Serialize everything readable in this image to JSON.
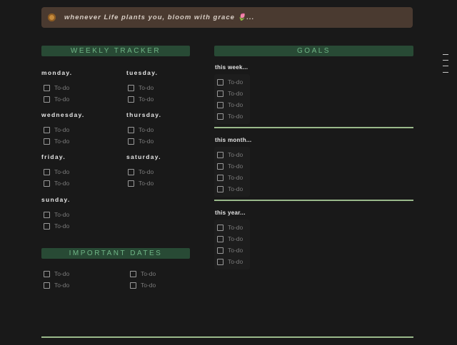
{
  "callout": {
    "icon": "flower-icon",
    "text": "whenever Life plants you, bloom with grace 🌷..."
  },
  "weekly": {
    "title": "WEEKLY TRACKER",
    "days": [
      {
        "label": "monday.",
        "todos": [
          "To-do",
          "To-do"
        ]
      },
      {
        "label": "tuesday.",
        "todos": [
          "To-do",
          "To-do"
        ]
      },
      {
        "label": "wednesday.",
        "todos": [
          "To-do",
          "To-do"
        ]
      },
      {
        "label": "thursday.",
        "todos": [
          "To-do",
          "To-do"
        ]
      },
      {
        "label": "friday.",
        "todos": [
          "To-do",
          "To-do"
        ]
      },
      {
        "label": "saturday.",
        "todos": [
          "To-do",
          "To-do"
        ]
      },
      {
        "label": "sunday.",
        "todos": [
          "To-do",
          "To-do"
        ]
      }
    ]
  },
  "important": {
    "title": "IMPORTANT DATES",
    "left": [
      "To-do",
      "To-do"
    ],
    "right": [
      "To-do",
      "To-do"
    ]
  },
  "goals": {
    "title": "GOALS",
    "sections": [
      {
        "label": "this week...",
        "todos": [
          "To-do",
          "To-do",
          "To-do",
          "To-do"
        ]
      },
      {
        "label": "this month...",
        "todos": [
          "To-do",
          "To-do",
          "To-do",
          "To-do"
        ]
      },
      {
        "label": "this year...",
        "todos": [
          "To-do",
          "To-do",
          "To-do",
          "To-do"
        ]
      }
    ]
  },
  "colors": {
    "header_bg": "#284a35",
    "header_text": "#6fb586",
    "divider": "#9ab98b",
    "callout_bg": "#4a3a30"
  }
}
